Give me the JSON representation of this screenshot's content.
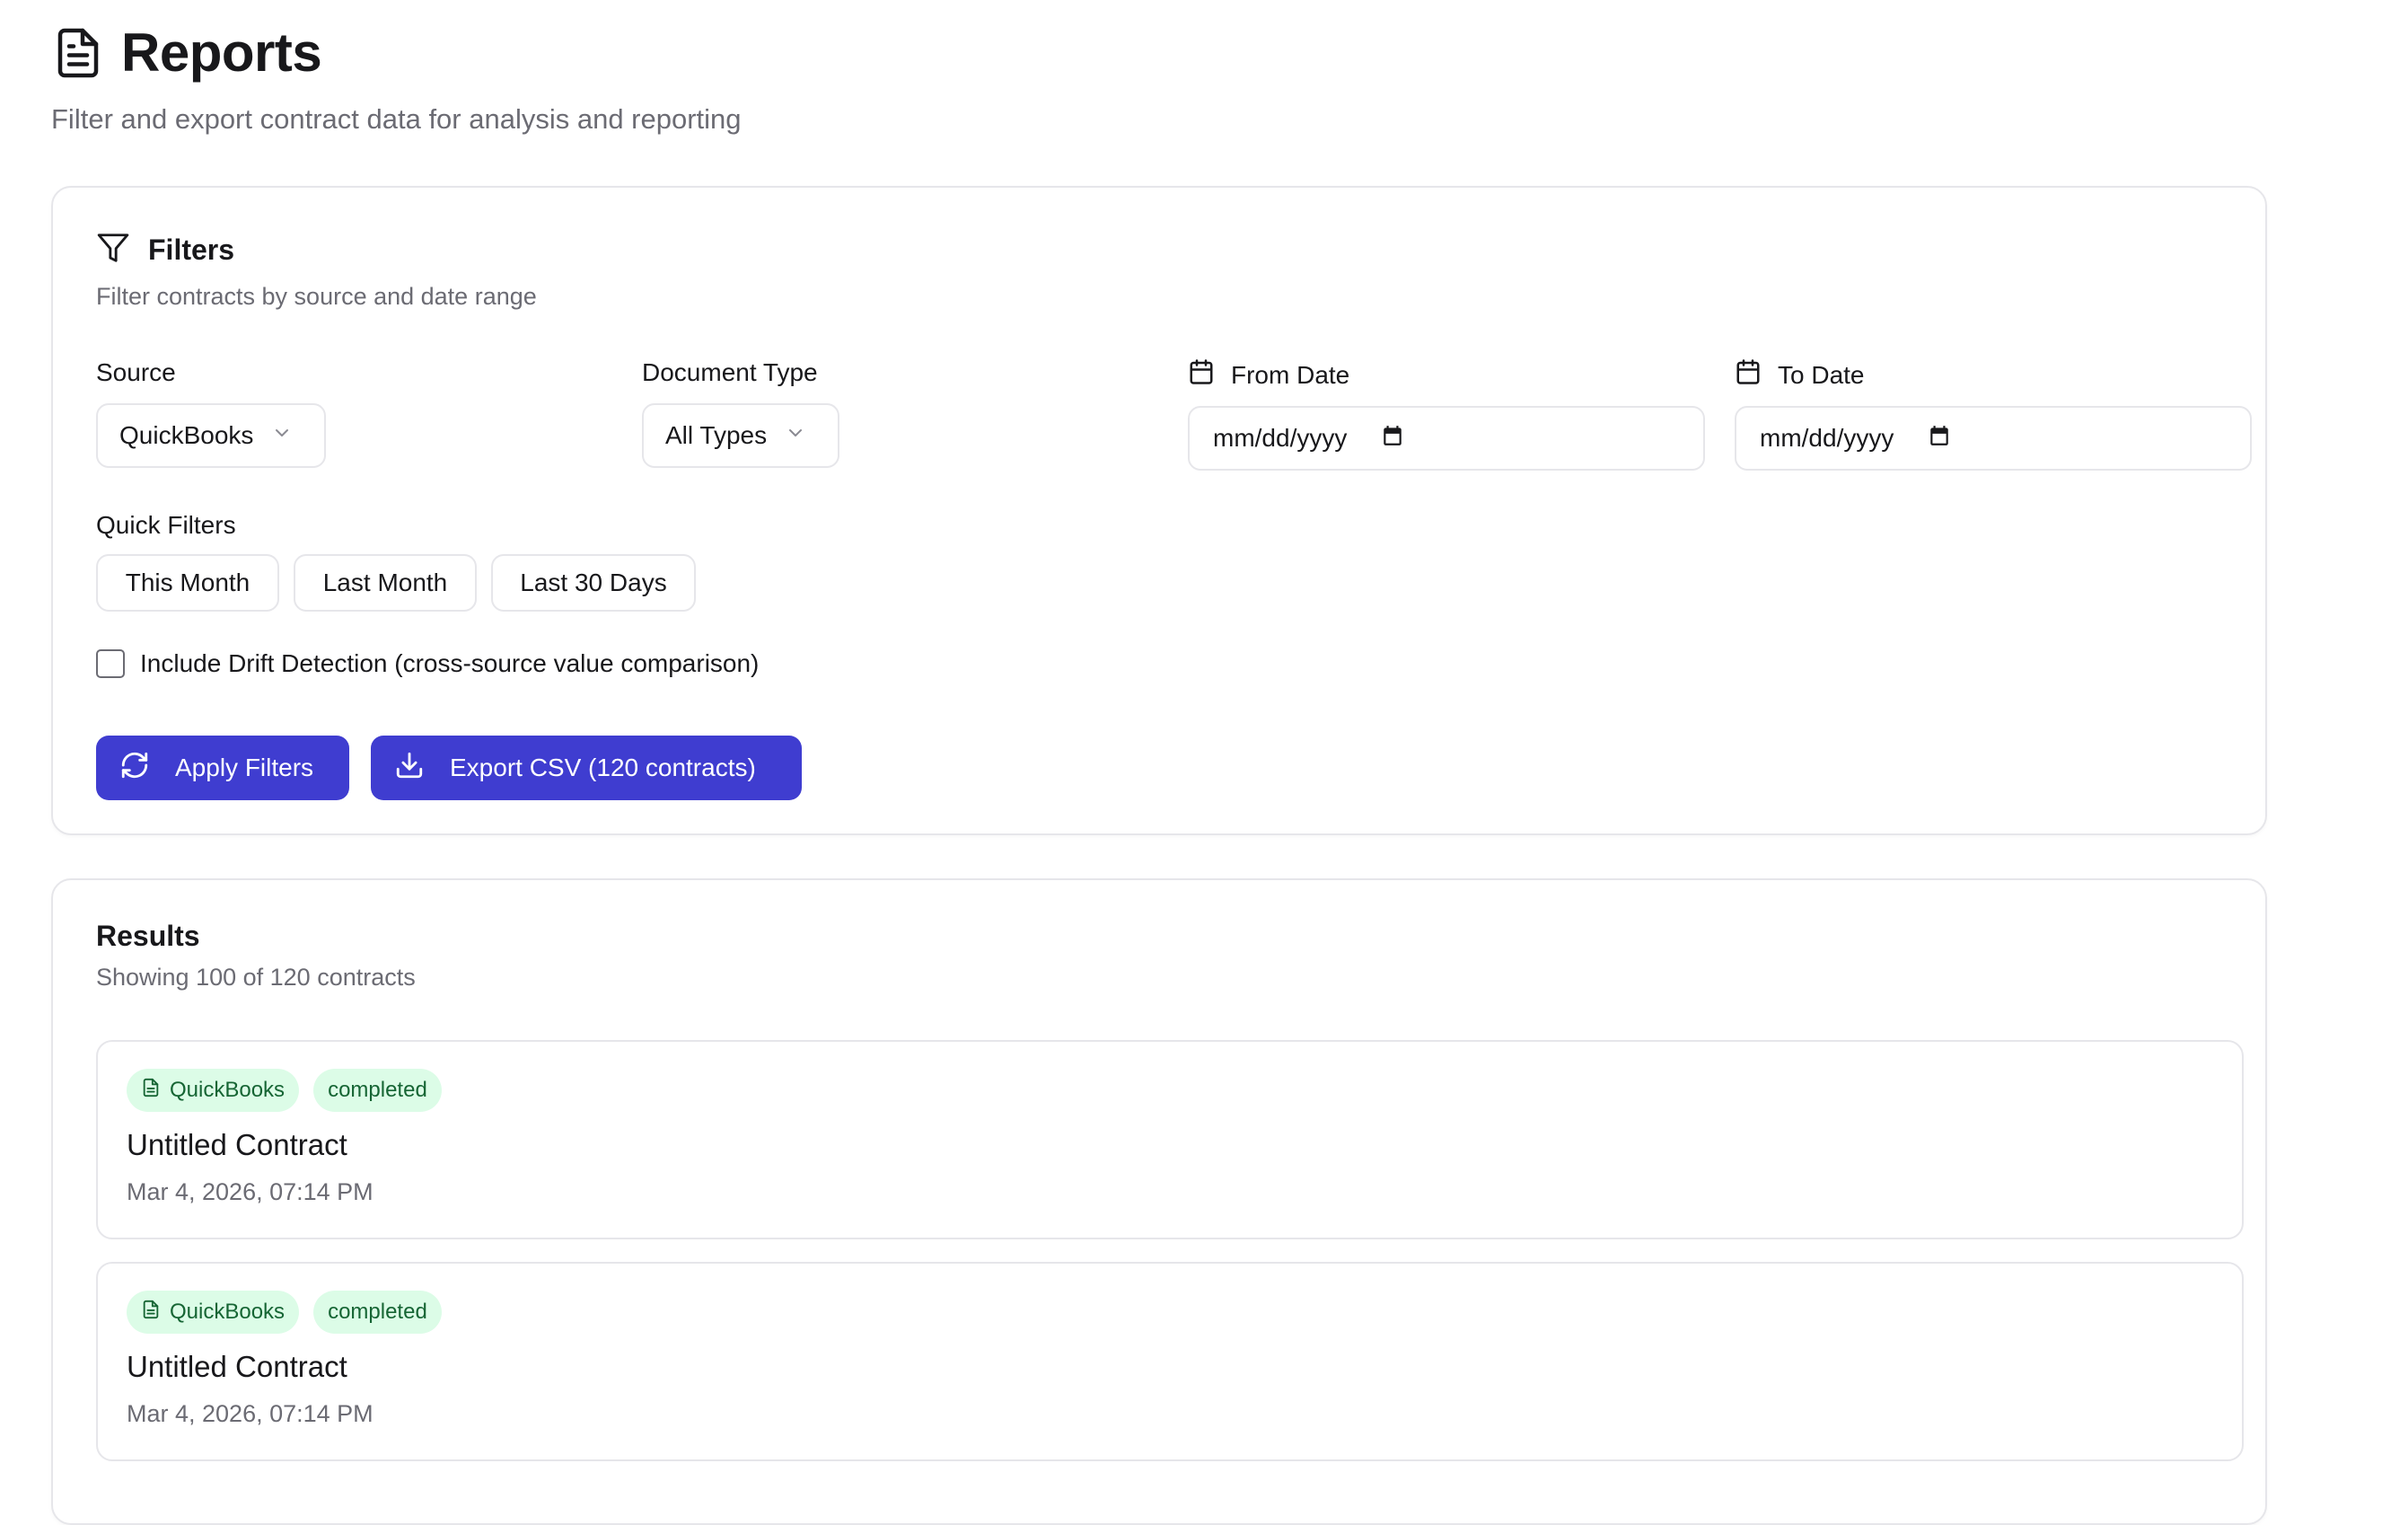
{
  "header": {
    "title": "Reports",
    "subtitle": "Filter and export contract data for analysis and reporting"
  },
  "filters": {
    "title": "Filters",
    "description": "Filter contracts by source and date range",
    "source": {
      "label": "Source",
      "value": "QuickBooks"
    },
    "document_type": {
      "label": "Document Type",
      "value": "All Types"
    },
    "from_date": {
      "label": "From Date",
      "placeholder": "mm/dd/yyyy"
    },
    "to_date": {
      "label": "To Date",
      "placeholder": "mm/dd/yyyy"
    },
    "quick_filters": {
      "label": "Quick Filters",
      "options": [
        "This Month",
        "Last Month",
        "Last 30 Days"
      ]
    },
    "drift_detection": {
      "label": "Include Drift Detection (cross-source value comparison)",
      "checked": false
    },
    "apply_button": "Apply Filters",
    "export_button": "Export CSV (120 contracts)"
  },
  "results": {
    "title": "Results",
    "summary": "Showing 100 of 120 contracts",
    "items": [
      {
        "source": "QuickBooks",
        "status": "completed",
        "title": "Untitled Contract",
        "date": "Mar 4, 2026, 07:14 PM"
      },
      {
        "source": "QuickBooks",
        "status": "completed",
        "title": "Untitled Contract",
        "date": "Mar 4, 2026, 07:14 PM"
      }
    ]
  },
  "colors": {
    "accent": "#3f3dd0",
    "badge_bg": "#dcfce7",
    "badge_text": "#166534",
    "border": "#e6e6ea",
    "muted_text": "#6b6b73"
  },
  "icons": {
    "header": "file-text-icon",
    "filters": "filter-icon",
    "date": "calendar-icon",
    "apply": "refresh-icon",
    "export": "download-icon",
    "source_badge": "file-text-icon",
    "dropdown": "chevron-down-icon"
  }
}
